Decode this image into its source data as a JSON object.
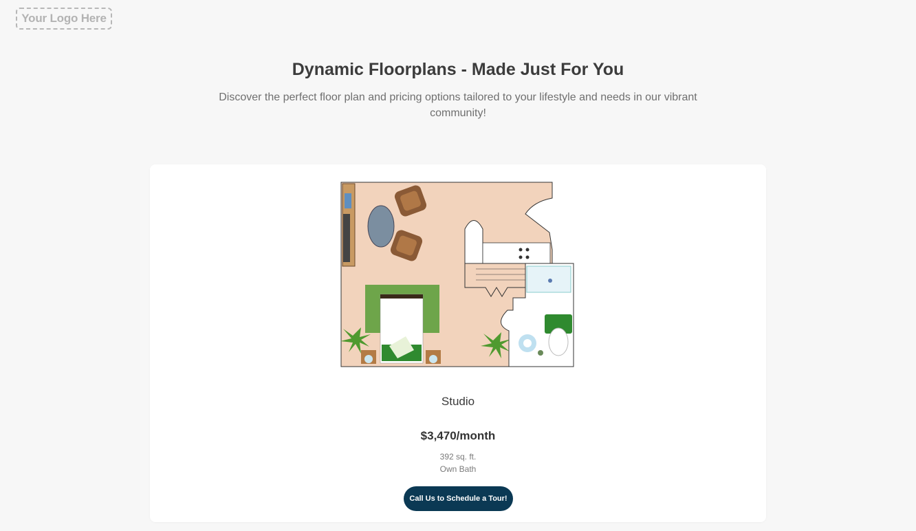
{
  "header": {
    "logo_text": "Your Logo Here"
  },
  "hero": {
    "title": "Dynamic Floorplans - Made Just For You",
    "subtitle": "Discover the perfect floor plan and pricing options tailored to your lifestyle and needs in our vibrant community!"
  },
  "card": {
    "image_icon": "studio-floorplan-image",
    "name": "Studio",
    "price": "$3,470/month",
    "sqft": "392 sq. ft.",
    "bath": "Own Bath",
    "cta_label": "Call Us to Schedule a Tour!",
    "cta_color": "#0b3954"
  }
}
